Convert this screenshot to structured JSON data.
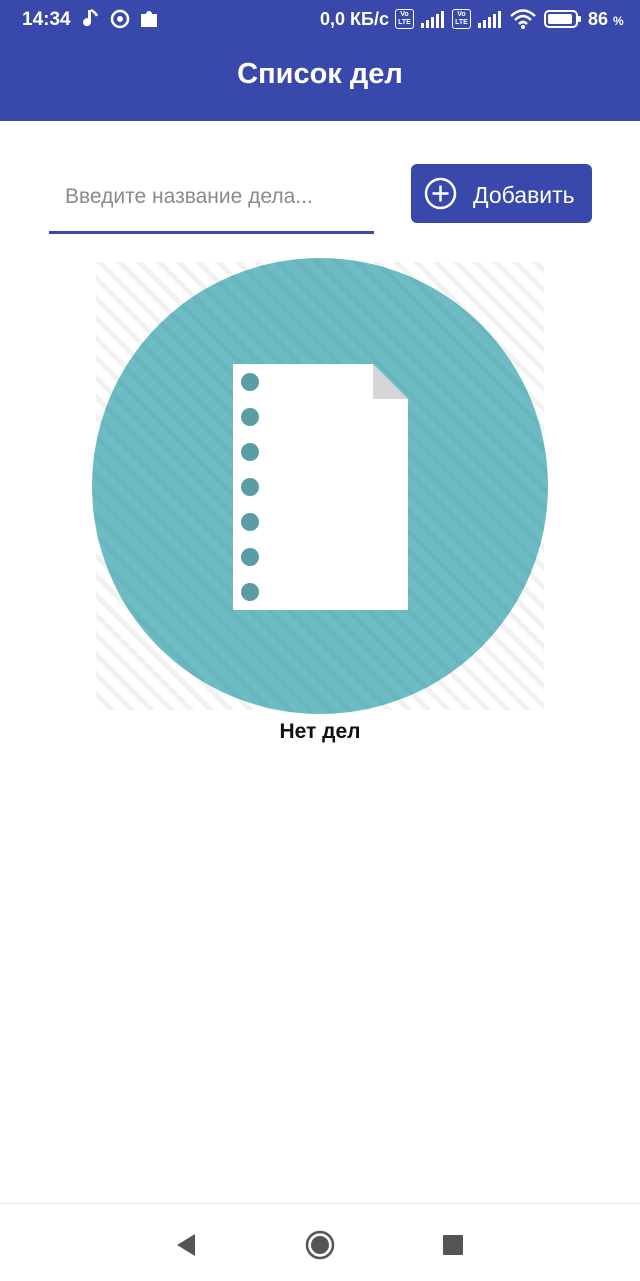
{
  "status_bar": {
    "time": "14:34",
    "net_speed": "0,0 КБ/с",
    "volte_badge": "Vo LTE",
    "battery_percent": "86",
    "battery_unit": "%"
  },
  "app_bar": {
    "title": "Список дел"
  },
  "task_form": {
    "placeholder": "Введите название дела...",
    "value": "",
    "add_label": "Добавить"
  },
  "empty_state": {
    "icon": "document-list-icon",
    "message": "Нет дел"
  },
  "colors": {
    "primary": "#3949ab",
    "illustration_circle": "#6dbcc4",
    "dot": "#5b9da4"
  },
  "nav_bar": {
    "back": "back-icon",
    "home": "home-icon",
    "recents": "recents-icon"
  }
}
